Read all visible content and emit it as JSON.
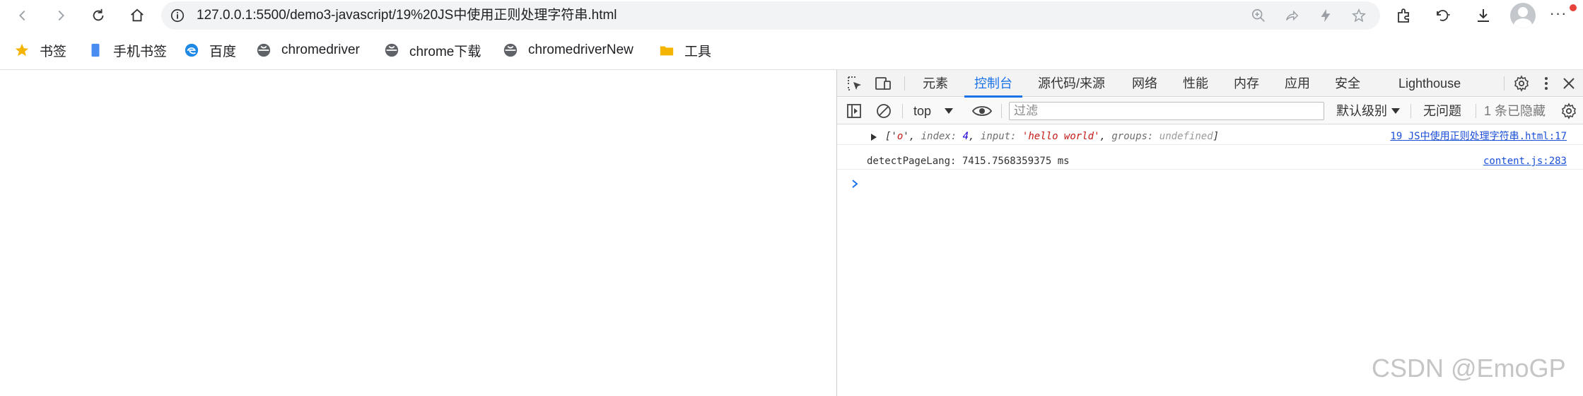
{
  "browser": {
    "url": "127.0.0.1:5500/demo3-javascript/19%20JS中使用正则处理字符串.html",
    "icons": {
      "back": "back-arrow-icon",
      "forward": "forward-arrow-icon",
      "reload": "reload-icon",
      "home": "home-icon",
      "info": "info-icon",
      "zoom": "zoom-icon",
      "share": "share-icon",
      "performance": "lightning-icon",
      "favorite": "star-icon",
      "extensions": "puzzle-icon",
      "history": "history-icon",
      "downloads": "download-icon",
      "profile": "avatar-icon",
      "more": "more-dots-icon"
    },
    "more_label": "···"
  },
  "bookmarks": [
    {
      "label": "书签",
      "icon": "star-icon",
      "color": "#f5b400"
    },
    {
      "label": "手机书签",
      "icon": "phone-icon",
      "color": "#4a8df0"
    },
    {
      "label": "百度",
      "icon": "edge-icon",
      "color": "#1e88e5"
    },
    {
      "label": "chromedriver",
      "icon": "globe-icon",
      "color": "#5f6368"
    },
    {
      "label": "chrome下载",
      "icon": "globe-icon",
      "color": "#5f6368"
    },
    {
      "label": "chromedriverNew",
      "icon": "globe-icon",
      "color": "#5f6368"
    },
    {
      "label": "工具",
      "icon": "folder-icon",
      "color": "#f5b400"
    }
  ],
  "devtools": {
    "tabs": [
      "元素",
      "控制台",
      "源代码/来源",
      "网络",
      "性能",
      "内存",
      "应用",
      "安全",
      "Lighthouse"
    ],
    "active_tab": "控制台",
    "context": "top",
    "filter_placeholder": "过滤",
    "levels": "默认级别",
    "issues": "无问题",
    "hidden": "1 条已隐藏",
    "accent": "#1a73e8"
  },
  "console": {
    "entry1": {
      "open": "['",
      "match": "o",
      "sep1": "', ",
      "k_index": "index: ",
      "v_index": "4",
      "sep2": ", ",
      "k_input": "input: ",
      "v_input": "'hello world'",
      "sep3": ", ",
      "k_groups": "groups: ",
      "v_groups": "undefined",
      "close": "]",
      "source": "19 JS中使用正则处理字符串.html:17"
    },
    "entry2": {
      "text": "detectPageLang: 7415.7568359375 ms",
      "source": "content.js:283"
    }
  },
  "watermark": "CSDN @EmoGP"
}
